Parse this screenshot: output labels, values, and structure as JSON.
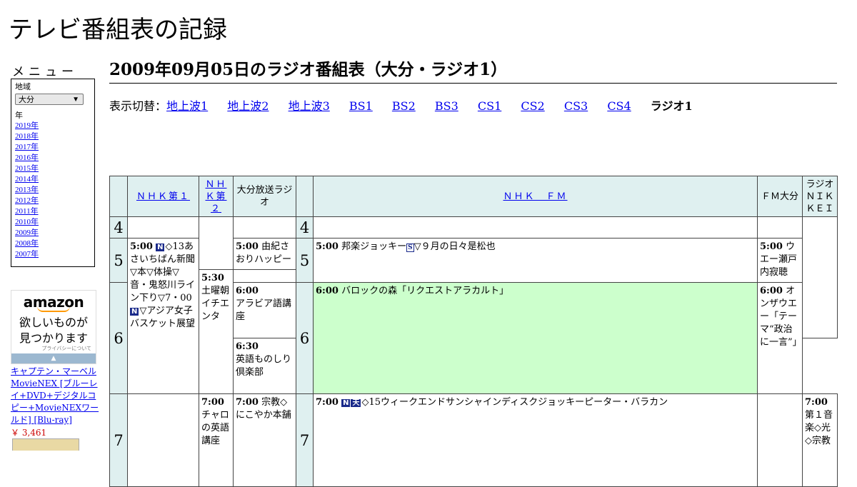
{
  "site": {
    "title": "テレビ番組表の記録"
  },
  "menu": {
    "heading": "メニュー",
    "region_label": "地域",
    "region_selected": "大分",
    "year_label": "年",
    "years": [
      "2019年",
      "2018年",
      "2017年",
      "2016年",
      "2015年",
      "2014年",
      "2013年",
      "2012年",
      "2011年",
      "2010年",
      "2009年",
      "2008年",
      "2007年"
    ]
  },
  "ad": {
    "logo": "amazon",
    "tagline_1": "欲しいものが",
    "tagline_2": "見つかります",
    "privacy": "プライバシーについて",
    "product_title": "キャプテン・マーベル MovieNEX [ブルーレイ+DVD+デジタルコピー+MovieNEXワールド] [Blu-ray]",
    "product_price": "￥ 3,461"
  },
  "page": {
    "title": "2009年09月05日のラジオ番組表（大分・ラジオ1）",
    "switch_label": "表示切替：",
    "switch_links": [
      "地上波1",
      "地上波2",
      "地上波3",
      "BS1",
      "BS2",
      "BS3",
      "CS1",
      "CS2",
      "CS3",
      "CS4"
    ],
    "switch_current": "ラジオ1"
  },
  "schedule": {
    "channels": {
      "nhk1": "ＮＨＫ第１",
      "nhk2": "ＮＨＫ第２",
      "obs": "大分放送ラジオ",
      "nhkfm": "ＮＨＫ　ＦＭ",
      "fmoita": "ＦＭ大分",
      "nikkei": "ラジオＮＩＫＫＥＩ"
    },
    "hours": [
      "4",
      "5",
      "6",
      "7"
    ],
    "programs": {
      "nhk1_500_time": "5:00",
      "nhk1_500_text": "◇13あさいちばん新聞▽本▽体操▽音・鬼怒川ライン下り▽7・00",
      "nhk1_500_text2": "▽アジア女子バスケット展望",
      "nhk2_600_time": "6:00",
      "nhk2_600_text": "アラビア語講座",
      "nhk2_630_time": "6:30",
      "nhk2_630_text": "英語ものしり倶楽部",
      "nhk2_700_time": "7:00",
      "nhk2_700_text": "チャロの英語講座",
      "obs_500_time": "5:00",
      "obs_500_text": "由紀さおりハッピー",
      "obs_530_time": "5:30",
      "obs_530_text": "土曜朝イチエンタ",
      "obs_700_time": "7:00",
      "obs_700_text": "宗教◇にこやか本舗",
      "fm_500_time": "5:00",
      "fm_500_text": "邦楽ジョッキー",
      "fm_500_text2": "▽９月の日々是松也",
      "fm_600_time": "6:00",
      "fm_600_text": "バロックの森「リクエストアラカルト」",
      "fm_700_time": "7:00",
      "fm_700_text": "◇15ウィークエンドサンシャインディスクジョッキーピーター・バラカン",
      "fmo_500_time": "5:00",
      "fmo_500_text": "ウエー瀬戸内寂聴",
      "fmo_600_time": "6:00",
      "fmo_600_text": "オンザウエー「テーマ“政治に一言”」",
      "nik_700_time": "7:00",
      "nik_700_text": "第１音楽◇光◇宗教"
    },
    "badges": {
      "news": "N",
      "stereo": "S",
      "weather": "天"
    }
  },
  "colors": {
    "header_bg": "#dff0f0",
    "highlight_bg": "#ccffcc",
    "badge_bg": "#1a2a8a",
    "link": "#0000ee"
  }
}
